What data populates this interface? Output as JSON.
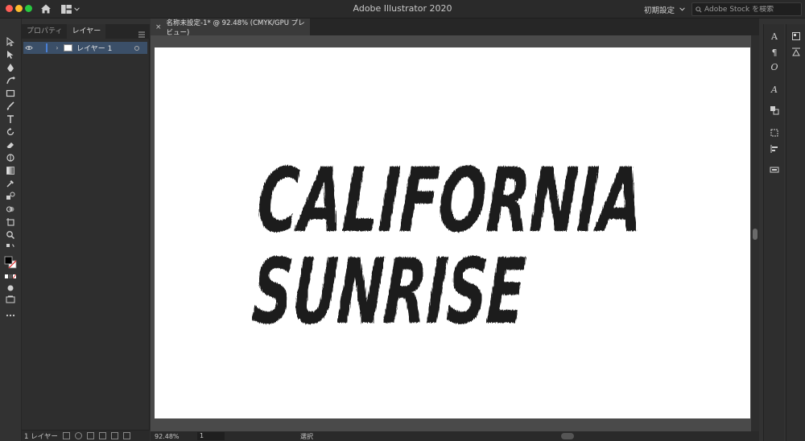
{
  "window": {
    "title": "Adobe Illustrator 2020",
    "workspace": "初期設定",
    "stock_search_placeholder": "Adobe Stock を検索"
  },
  "panel": {
    "tabs": [
      {
        "label": "プロパティ",
        "active": false
      },
      {
        "label": "レイヤー",
        "active": true
      }
    ],
    "layer": {
      "name": "レイヤー 1"
    },
    "footer": {
      "layer_count": "1 レイヤー"
    }
  },
  "document": {
    "tab_title": "名称未設定-1* @ 92.48% (CMYK/GPU プレビュー)",
    "artwork": {
      "line1": "CALIFORNIA",
      "line2": "SUNRISE"
    }
  },
  "status": {
    "zoom": "92.48%",
    "page": "1",
    "mode": "選択"
  },
  "right_panel": {
    "character_glyph": "A",
    "paragraph_glyph": "¶",
    "opentype_glyph": "O",
    "glyphs_glyph": "A"
  },
  "colors": {
    "accent": "#4a7fd4",
    "layer_selected": "#3b4f68",
    "ui_bg": "#323232",
    "artboard": "#ffffff",
    "pasteboard": "#4a4a4a"
  }
}
